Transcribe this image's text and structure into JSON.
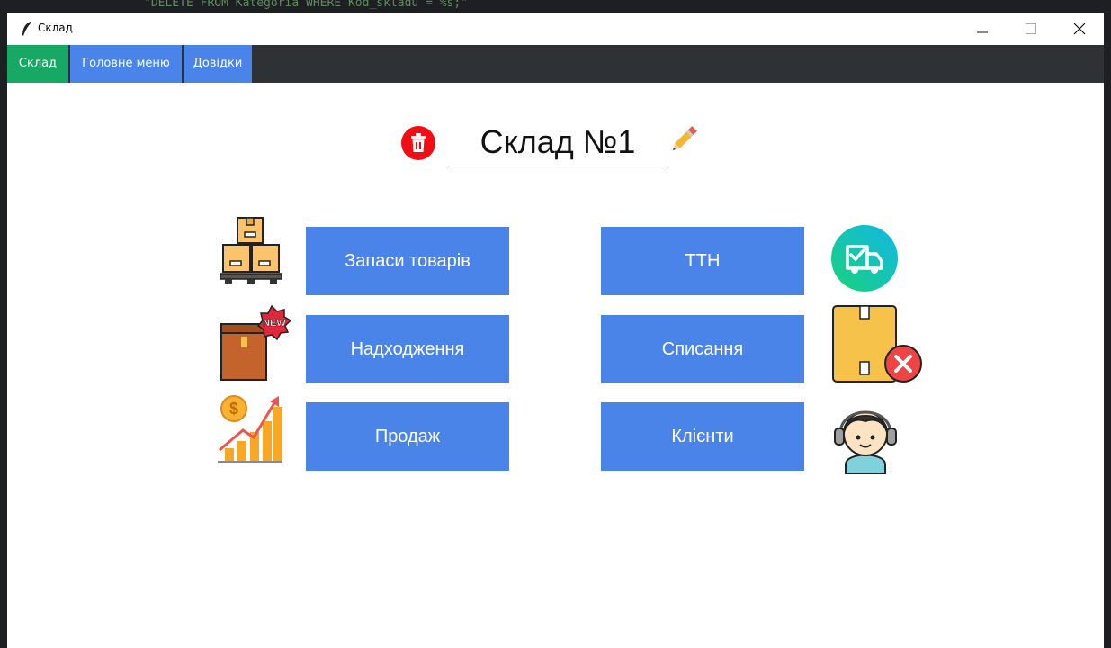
{
  "background_code": "\"DELETE FROM Kategoria WHERE Kod_skladu = %s;\"",
  "window": {
    "title": "Склад"
  },
  "menu": {
    "tabs": [
      {
        "label": "Склад"
      },
      {
        "label": "Головне меню"
      },
      {
        "label": "Довідки"
      }
    ]
  },
  "warehouse": {
    "name": "Склад №1"
  },
  "buttons": {
    "stock": "Запаси товарів",
    "ttn": "ТТН",
    "income": "Надходження",
    "writeoff": "Списання",
    "sales": "Продаж",
    "clients": "Клієнти"
  },
  "badges": {
    "new": "NEW"
  },
  "icons": {
    "trash": "trash-icon",
    "pencil": "pencil-icon",
    "boxes": "boxes-on-pallet-icon",
    "truck": "delivery-truck-check-icon",
    "new_box": "new-box-icon",
    "box_cancel": "box-cancel-icon",
    "sales_growth": "sales-growth-icon",
    "support": "customer-support-icon"
  },
  "colors": {
    "active_tab": "#18a866",
    "tab": "#4a84e8",
    "button": "#4a84e8",
    "menubar": "#2f3235",
    "trash": "#f20d14"
  }
}
